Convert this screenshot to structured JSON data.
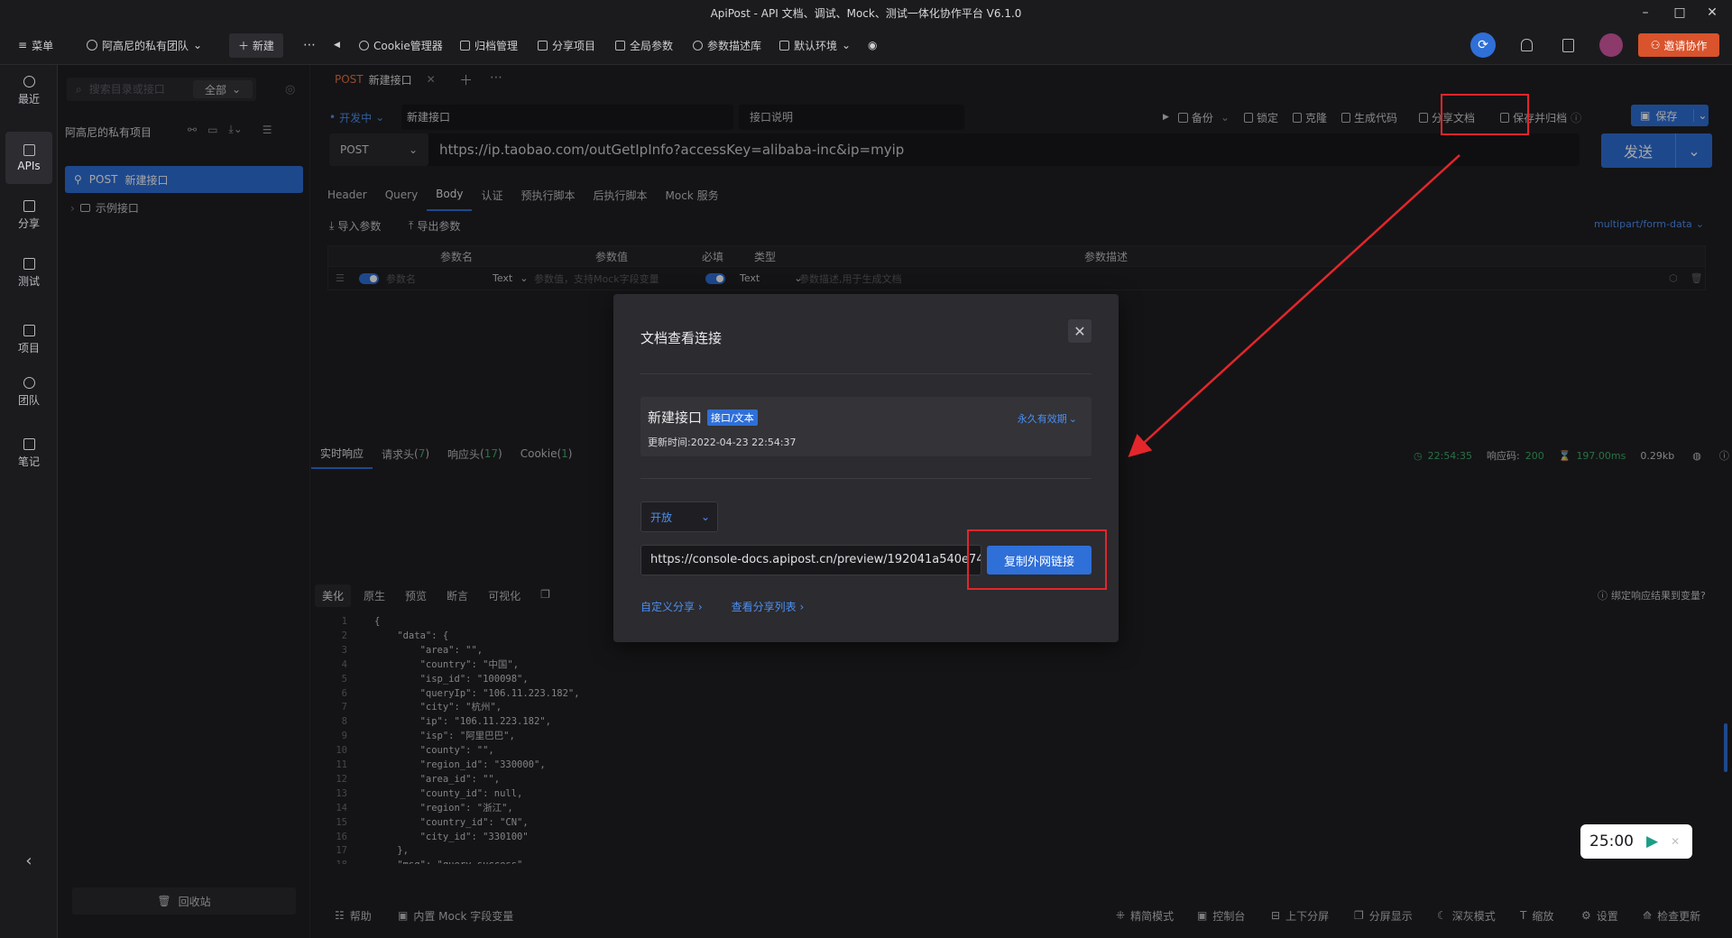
{
  "window": {
    "title": "ApiPost - API 文档、调试、Mock、测试一体化协作平台 V6.1.0"
  },
  "topbar": {
    "menu": "菜单",
    "team": "阿高尼的私有团队",
    "new": "新建",
    "items": [
      "Cookie管理器",
      "归档管理",
      "分享项目",
      "全局参数",
      "参数描述库",
      "默认环境"
    ],
    "invite": "邀请协作"
  },
  "leftnav": {
    "items": [
      "最近",
      "APIs",
      "分享",
      "测试",
      "项目",
      "团队",
      "笔记"
    ]
  },
  "sidebar": {
    "search_placeholder": "搜索目录或接口",
    "filter": "全部",
    "project": "阿高尼的私有项目",
    "active_method": "POST",
    "active_name": "新建接口",
    "folder": "示例接口",
    "trash": "回收站"
  },
  "main": {
    "tab_method": "POST",
    "tab_name": "新建接口",
    "status": "开发中",
    "api_name": "新建接口",
    "api_desc": "接口说明",
    "actions": [
      "备份",
      "锁定",
      "克隆",
      "生成代码",
      "分享文档",
      "保存并归档"
    ],
    "save": "保存",
    "method": "POST",
    "url": "https://ip.taobao.com/outGetIpInfo?accessKey=alibaba-inc&ip=myip",
    "send": "发送",
    "subtabs": [
      "Header",
      "Query",
      "Body",
      "认证",
      "预执行脚本",
      "后执行脚本",
      "Mock 服务"
    ],
    "import": "导入参数",
    "export": "导出参数",
    "body_type": "multipart/form-data",
    "table_head": [
      "参数名",
      "参数值",
      "必填",
      "类型",
      "参数描述"
    ],
    "row": {
      "name_ph": "参数名",
      "type1": "Text",
      "value_ph": "参数值，支持Mock字段变量",
      "type2": "Text",
      "desc_ph": "参数描述,用于生成文档"
    },
    "resp_tabs": [
      "实时响应",
      "请求头",
      "响应头",
      "Cookie"
    ],
    "resp_counts": [
      "7",
      "17",
      "1"
    ],
    "resp_time": "22:54:35",
    "resp_code_label": "响应码:",
    "resp_code": "200",
    "resp_ms": "197.00ms",
    "resp_size": "0.29kb",
    "view_tabs": [
      "美化",
      "原生",
      "预览",
      "断言",
      "可视化"
    ],
    "bind_hint": "绑定响应结果到变量?",
    "code_lines": [
      "{",
      "    \"data\": {",
      "        \"area\": \"\",",
      "        \"country\": \"中国\",",
      "        \"isp_id\": \"100098\",",
      "        \"queryIp\": \"106.11.223.182\",",
      "        \"city\": \"杭州\",",
      "        \"ip\": \"106.11.223.182\",",
      "        \"isp\": \"阿里巴巴\",",
      "        \"county\": \"\",",
      "        \"region_id\": \"330000\",",
      "        \"area_id\": \"\",",
      "        \"county_id\": null,",
      "        \"region\": \"浙江\",",
      "        \"country_id\": \"CN\",",
      "        \"city_id\": \"330100\"",
      "    },",
      "    \"msg\": \"query success\""
    ],
    "statusbar": [
      "帮助",
      "内置 Mock 字段变量",
      "精简模式",
      "控制台",
      "上下分屏",
      "分屏显示",
      "深灰模式",
      "缩放",
      "设置",
      "检查更新"
    ]
  },
  "modal": {
    "title": "文档查看连接",
    "card_title": "新建接口",
    "card_tag": "接口/文本",
    "validity": "永久有效期",
    "updated": "更新时间:2022-04-23 22:54:37",
    "visibility": "开放",
    "link": "https://console-docs.apipost.cn/preview/192041a540e74",
    "copy": "复制外网链接",
    "custom_share": "自定义分享",
    "view_list": "查看分享列表"
  },
  "timer": {
    "value": "25:00"
  },
  "colors": {
    "accent": "#2f6fd8",
    "post": "#e8734a",
    "annotation": "#e3262b",
    "invite": "#d9532c"
  }
}
